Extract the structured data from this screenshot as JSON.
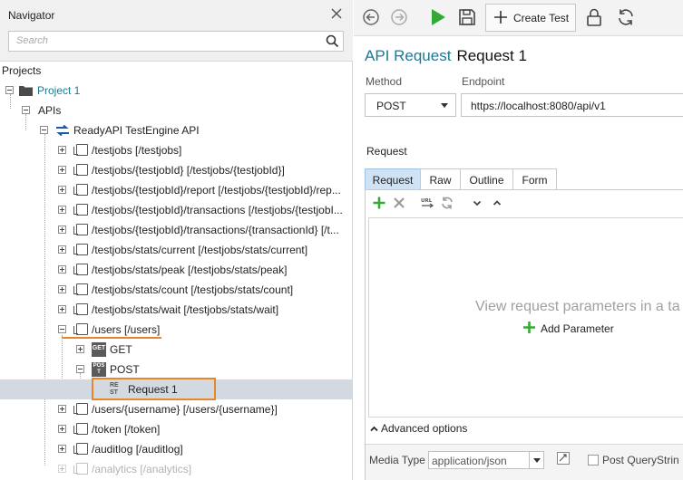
{
  "navigator": {
    "title": "Navigator",
    "search_placeholder": "Search",
    "projects_label": "Projects",
    "project_name": "Project 1",
    "apis_label": "APIs",
    "api_name": "ReadyAPI TestEngine API",
    "resources": [
      "/testjobs [/testjobs]",
      "/testjobs/{testjobId} [/testjobs/{testjobId}]",
      "/testjobs/{testjobId}/report [/testjobs/{testjobId}/rep...",
      "/testjobs/{testjobId}/transactions [/testjobs/{testjobI...",
      "/testjobs/{testjobId}/transactions/{transactionId} [/t...",
      "/testjobs/stats/current [/testjobs/stats/current]",
      "/testjobs/stats/peak [/testjobs/stats/peak]",
      "/testjobs/stats/count [/testjobs/stats/count]",
      "/testjobs/stats/wait [/testjobs/stats/wait]",
      "/users [/users]"
    ],
    "users_children": {
      "get_badge": "GET",
      "get_label": "GET",
      "post_badge": "POST",
      "post_label": "POST",
      "request_badge": "REST",
      "request_label": "Request 1"
    },
    "more_resources": [
      "/users/{username} [/users/{username}]",
      "/token [/token]",
      "/auditlog [/auditlog]",
      "/analytics [/analytics]"
    ]
  },
  "toolbar": {
    "create_test_label": "Create Test",
    "back_icon": "back-icon",
    "forward_icon": "forward-icon",
    "run_icon": "run-icon",
    "save_icon": "save-icon",
    "lock_icon": "lock-icon",
    "refresh_icon": "refresh-icon"
  },
  "request": {
    "kind": "API Request",
    "name": "Request 1",
    "method_label": "Method",
    "method_value": "POST",
    "endpoint_label": "Endpoint",
    "endpoint_value": "https://localhost:8080/api/v1",
    "section_label": "Request",
    "tabs": [
      "Request",
      "Raw",
      "Outline",
      "Form"
    ],
    "active_tab": "Request",
    "empty_message": "View request parameters in a ta",
    "add_parameter_label": "Add Parameter",
    "advanced_options_label": "Advanced options",
    "media_type_label": "Media Type",
    "media_type_value": "application/json",
    "post_query_label": "Post QueryStrin"
  },
  "colors": {
    "accent": "#1d7894",
    "green": "#35a935",
    "highlight": "#e8862a",
    "selection": "#d3d9e1"
  }
}
